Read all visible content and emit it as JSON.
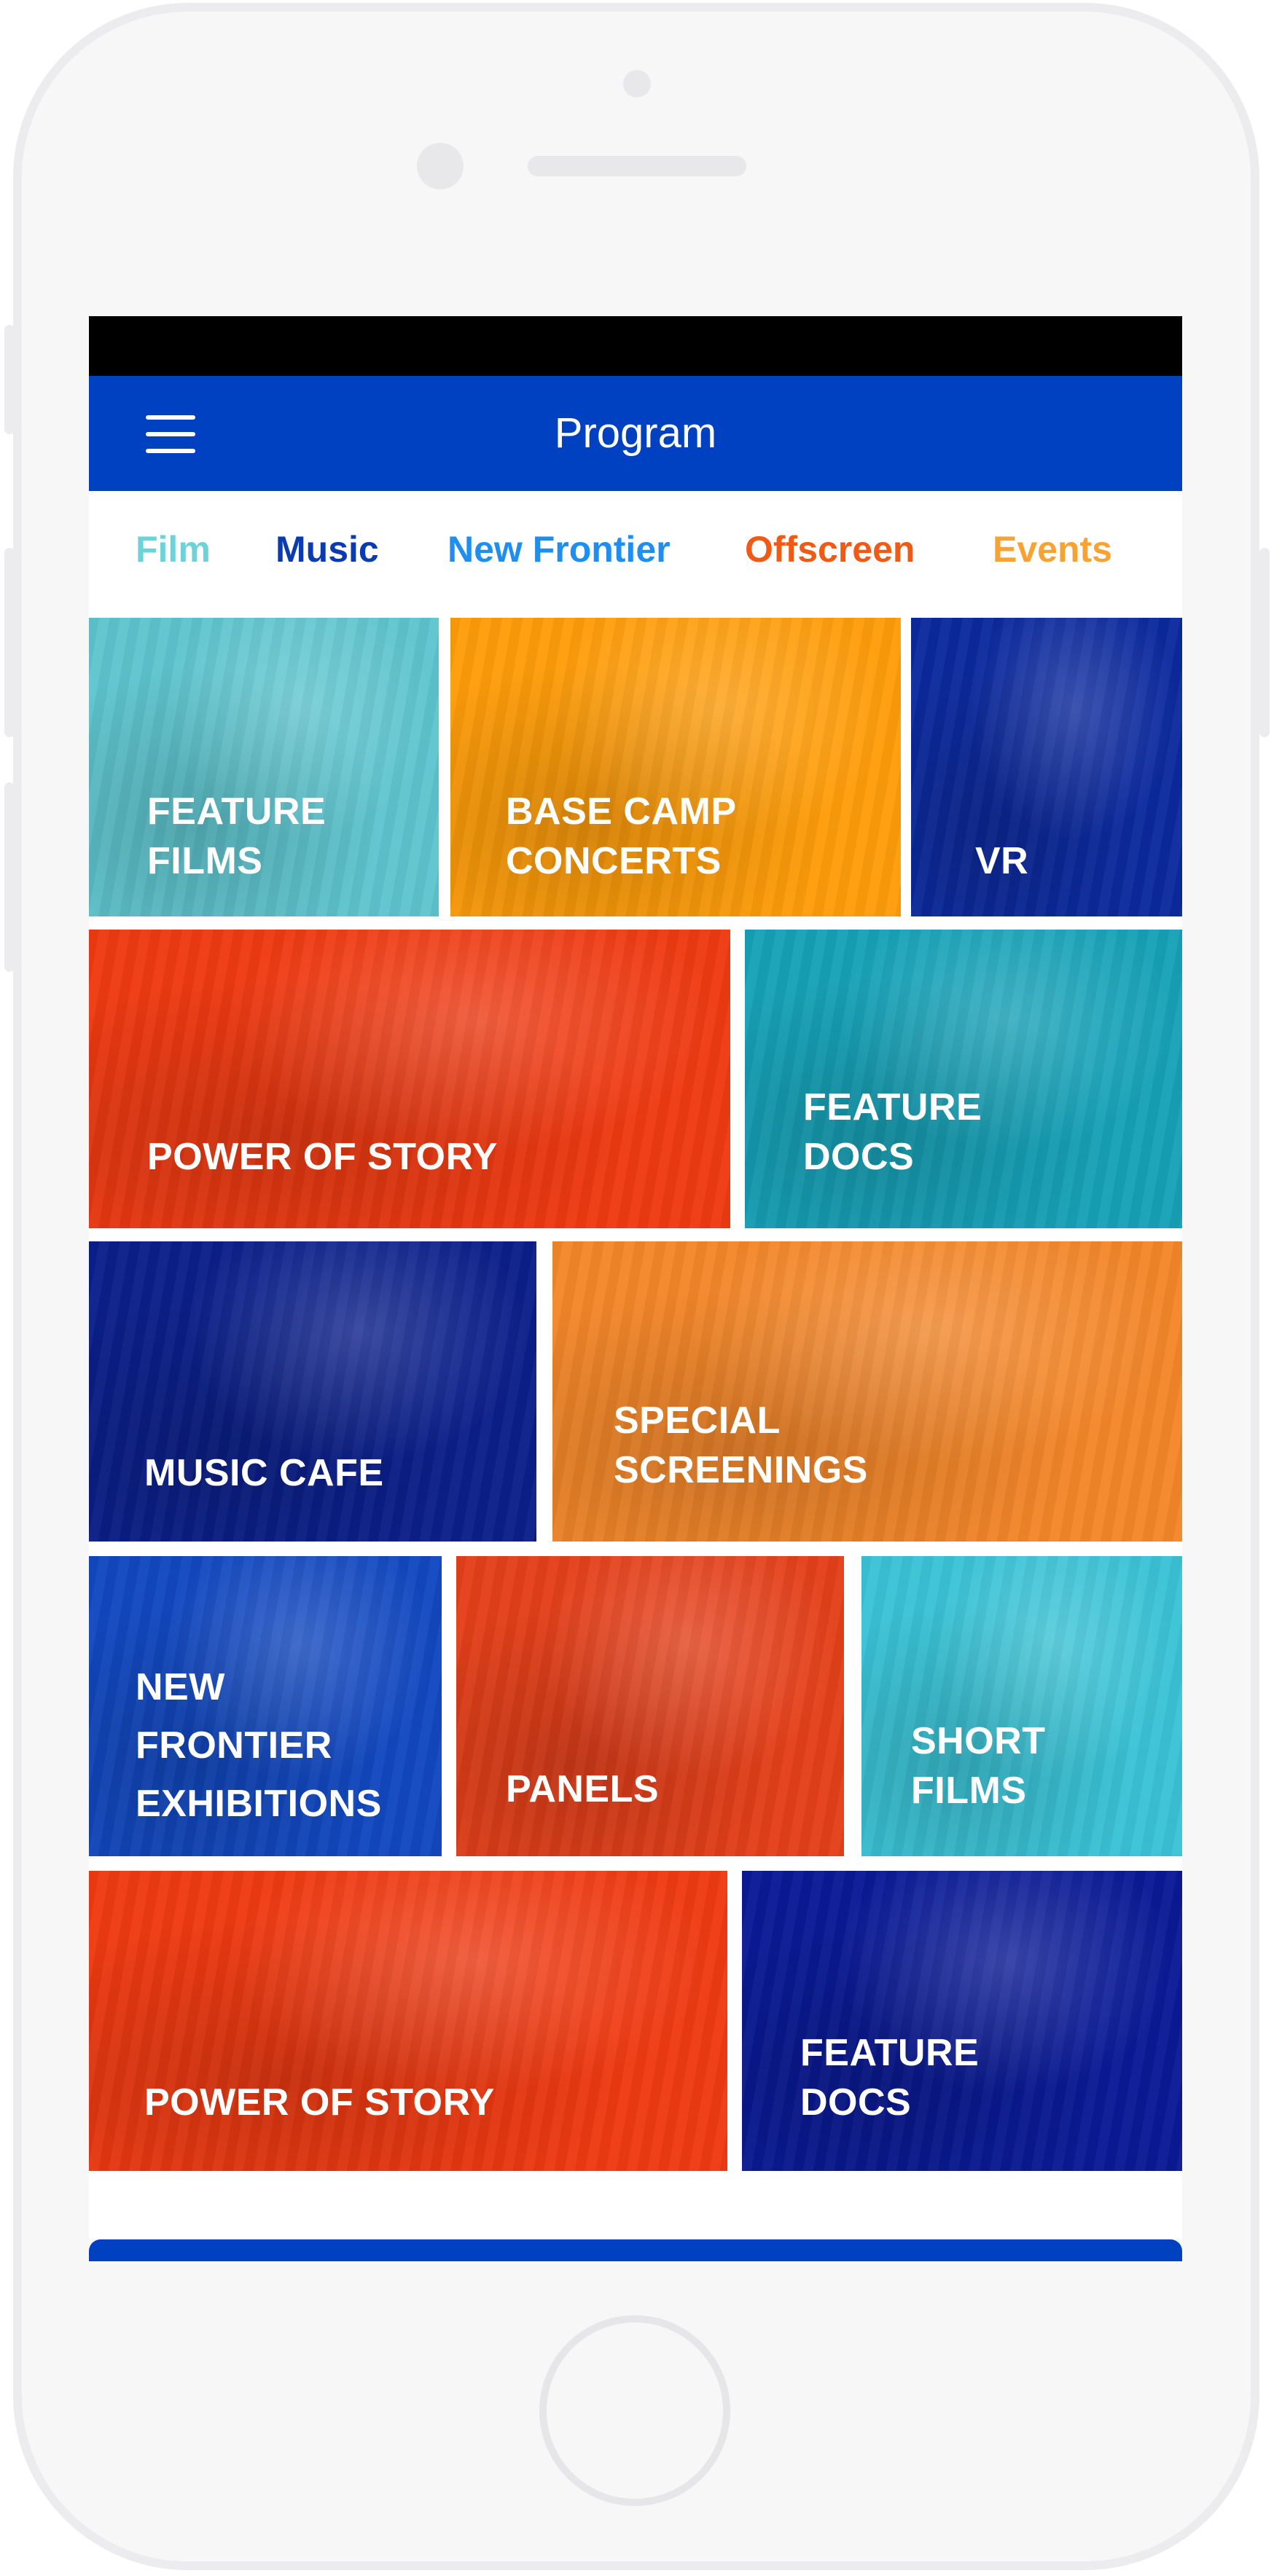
{
  "header": {
    "title": "Program",
    "menu_icon": "hamburger-menu-icon"
  },
  "tabs": [
    {
      "label": "Film",
      "color": "#6ed3d8"
    },
    {
      "label": "Music",
      "color": "#0b3bb0"
    },
    {
      "label": "New Frontier",
      "color": "#1e8ef0"
    },
    {
      "label": "Offscreen",
      "color": "#f05a14"
    },
    {
      "label": "Events",
      "color": "#f7a333"
    }
  ],
  "tiles": [
    {
      "label": "FEATURE\nFILMS",
      "color": "#5fc5cf"
    },
    {
      "label": "BASE CAMP\nCONCERTS",
      "color": "#ff9d0a"
    },
    {
      "label": "VR",
      "color": "#0c2a9e"
    },
    {
      "label": "POWER OF STORY",
      "color": "#ef3a12"
    },
    {
      "label": "FEATURE\nDOCS",
      "color": "#17a2b8"
    },
    {
      "label": "MUSIC CAFE",
      "color": "#0b1f8a"
    },
    {
      "label": "SPECIAL\nSCREENINGS",
      "color": "#f4872a"
    },
    {
      "label": "NEW\nFRONTIER\nEXHIBITIONS",
      "color": "#1248c0"
    },
    {
      "label": "PANELS",
      "color": "#e4401a"
    },
    {
      "label": "SHORT\nFILMS",
      "color": "#3ac3d6"
    },
    {
      "label": "POWER OF STORY",
      "color": "#ef3a12"
    },
    {
      "label": "FEATURE\nDOCS",
      "color": "#0a1a96"
    }
  ],
  "colors": {
    "brand_blue": "#0041c2",
    "status_bar": "#000000"
  }
}
